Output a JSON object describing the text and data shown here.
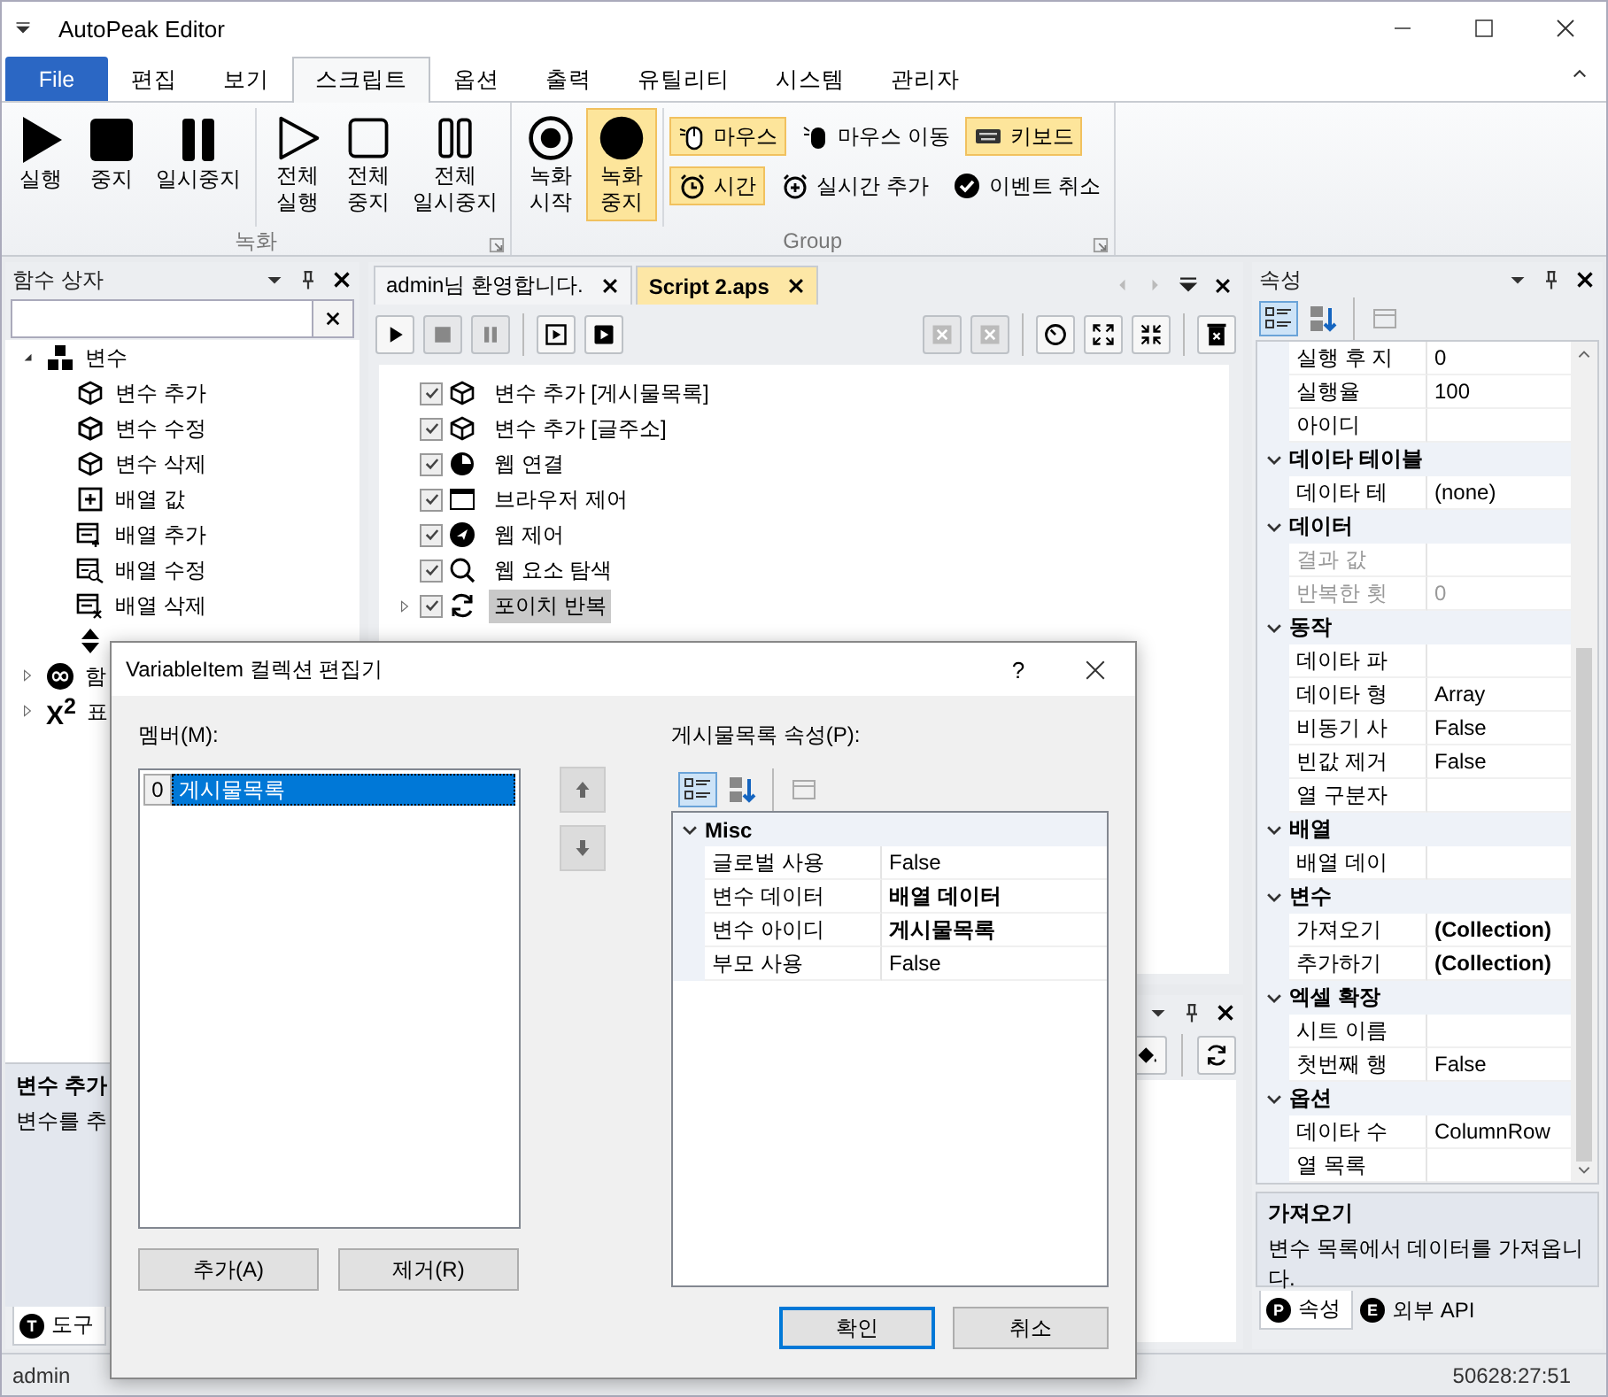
{
  "window": {
    "title": "AutoPeak Editor"
  },
  "menu_tabs": [
    {
      "label": "File",
      "kind": "file",
      "selected": false
    },
    {
      "label": "편집",
      "kind": "tab",
      "selected": false
    },
    {
      "label": "보기",
      "kind": "tab",
      "selected": false
    },
    {
      "label": "스크립트",
      "kind": "tab",
      "selected": true
    },
    {
      "label": "옵션",
      "kind": "tab",
      "selected": false
    },
    {
      "label": "출력",
      "kind": "tab",
      "selected": false
    },
    {
      "label": "유틸리티",
      "kind": "tab",
      "selected": false
    },
    {
      "label": "시스템",
      "kind": "tab",
      "selected": false
    },
    {
      "label": "관리자",
      "kind": "tab",
      "selected": false
    }
  ],
  "ribbon": {
    "groups": [
      {
        "label": "녹화",
        "sections": [
          [
            {
              "kind": "large",
              "label": "실행",
              "selected": false
            },
            {
              "kind": "large",
              "label": "중지",
              "selected": false
            },
            {
              "kind": "large",
              "label": "일시중지",
              "selected": false
            }
          ],
          [
            {
              "kind": "large",
              "label": "전체\n실행",
              "selected": false
            },
            {
              "kind": "large",
              "label": "전체\n중지",
              "selected": false
            },
            {
              "kind": "large",
              "label": "전체\n일시중지",
              "selected": false
            }
          ]
        ]
      },
      {
        "label": "Group",
        "sections": [
          [
            {
              "kind": "large",
              "label": "녹화\n시작",
              "selected": false
            },
            {
              "kind": "large",
              "label": "녹화\n중지",
              "selected": true
            }
          ],
          [
            {
              "kind": "small",
              "label": "마우스",
              "selected": true
            },
            {
              "kind": "small",
              "label": "마우스 이동",
              "selected": false
            },
            {
              "kind": "small",
              "label": "키보드",
              "selected": true
            },
            {
              "kind": "small",
              "label": "시간",
              "selected": true
            },
            {
              "kind": "small",
              "label": "실시간 추가",
              "selected": false
            },
            {
              "kind": "small",
              "label": "이벤트 취소",
              "selected": false
            }
          ]
        ]
      }
    ]
  },
  "function_box": {
    "title": "함수 상자",
    "tree": [
      {
        "label": "변수",
        "expanded": true,
        "children": [
          {
            "kind": "item",
            "label": "변수 추가"
          },
          {
            "kind": "item",
            "label": "변수 수정"
          },
          {
            "kind": "item",
            "label": "변수 삭제"
          },
          {
            "kind": "item",
            "label": "배열 값"
          },
          {
            "kind": "item",
            "label": "배열 추가"
          },
          {
            "kind": "item",
            "label": "배열 수정"
          },
          {
            "kind": "item",
            "label": "배열 삭제"
          },
          {
            "kind": "covered"
          }
        ]
      },
      {
        "label": "함",
        "expanded": false
      },
      {
        "label": "표",
        "expanded": false,
        "icon_text": "X$^{2}$"
      }
    ],
    "description": {
      "title": "변수 추가",
      "text": "변수를 추"
    },
    "bottom_tabs": [
      {
        "label": "도구",
        "badge": "T",
        "selected": true
      }
    ]
  },
  "document": {
    "tabs": [
      {
        "label": "admin님 환영합니다.",
        "selected": false
      },
      {
        "label": "Script 2.aps",
        "selected": true
      }
    ],
    "toolbar": {
      "left": [
        [
          {
            "disabled": false
          },
          {
            "disabled": true
          },
          {
            "disabled": true
          }
        ],
        [
          {
            "disabled": false
          },
          {
            "disabled": false
          }
        ]
      ],
      "right": [
        [
          {
            "disabled": true
          },
          {
            "disabled": true
          }
        ],
        [
          {
            "disabled": false
          },
          {
            "disabled": false
          },
          {
            "disabled": false
          }
        ],
        [
          {
            "disabled": false
          }
        ]
      ]
    },
    "script": [
      {
        "label": "변수 추가 [게시물목록]",
        "checked": true,
        "has_children": false,
        "selected": false
      },
      {
        "label": "변수 추가 [글주소]",
        "checked": true,
        "has_children": false,
        "selected": false
      },
      {
        "label": "웹 연결",
        "checked": true,
        "has_children": false,
        "selected": false
      },
      {
        "label": "브라우저 제어",
        "checked": true,
        "has_children": false,
        "selected": false
      },
      {
        "label": "웹 제어",
        "checked": true,
        "has_children": false,
        "selected": false
      },
      {
        "label": "웹 요소 탐색",
        "checked": true,
        "has_children": false,
        "selected": false
      },
      {
        "label": "포이치 반복",
        "checked": true,
        "has_children": true,
        "selected": true
      }
    ]
  },
  "properties": {
    "title": "속성",
    "categories": [
      {
        "rows": [
          {
            "name": "실행 후 지",
            "value": "0",
            "disabled": false,
            "bold": false
          },
          {
            "name": "실행율",
            "value": "100",
            "disabled": false,
            "bold": false
          },
          {
            "name": "아이디",
            "disabled": false
          }
        ]
      },
      {
        "label": "데이타 테이블",
        "expanded": true,
        "rows": [
          {
            "name": "데이타 테",
            "value": "(none)",
            "disabled": false,
            "bold": false
          }
        ]
      },
      {
        "label": "데이터",
        "expanded": true,
        "rows": [
          {
            "name": "결과 값",
            "disabled": true
          },
          {
            "name": "반복한 횟",
            "value": "0",
            "disabled": true,
            "bold": false
          }
        ]
      },
      {
        "label": "동작",
        "expanded": true,
        "rows": [
          {
            "name": "데이타 파",
            "disabled": false
          },
          {
            "name": "데이타 형",
            "value": "Array",
            "disabled": false,
            "bold": false
          },
          {
            "name": "비동기 사",
            "value": "False",
            "disabled": false,
            "bold": false
          },
          {
            "name": "빈값 제거",
            "value": "False",
            "disabled": false,
            "bold": false
          },
          {
            "name": "열 구분자",
            "disabled": false
          }
        ]
      },
      {
        "label": "배열",
        "expanded": true,
        "rows": [
          {
            "name": "배열 데이",
            "disabled": false
          }
        ]
      },
      {
        "label": "변수",
        "expanded": true,
        "rows": [
          {
            "name": "가져오기",
            "value": "(Collection)",
            "disabled": false,
            "bold": true
          },
          {
            "name": "추가하기",
            "value": "(Collection)",
            "disabled": false,
            "bold": true
          }
        ]
      },
      {
        "label": "엑셀 확장",
        "expanded": true,
        "rows": [
          {
            "name": "시트 이름",
            "disabled": false
          },
          {
            "name": "첫번째 행",
            "value": "False",
            "disabled": false,
            "bold": false
          }
        ]
      },
      {
        "label": "옵션",
        "expanded": true,
        "rows": [
          {
            "name": "데이타 수",
            "value": "ColumnRow",
            "disabled": false,
            "bold": false
          },
          {
            "name": "열 목록",
            "disabled": false
          }
        ]
      }
    ],
    "description": {
      "title": "가져오기",
      "text": "변수 목록에서 데이터를 가져옵니다."
    },
    "bottom_tabs": [
      {
        "label": "속성",
        "badge": "P",
        "selected": true
      },
      {
        "label": "외부 API",
        "badge": "E",
        "selected": false
      }
    ]
  },
  "status_bar": {
    "user": "admin",
    "time": "50628:27:51"
  },
  "dialog": {
    "title": "VariableItem 컬렉션 편집기",
    "help": "?",
    "members_label": "멤버(M):",
    "members": [
      {
        "index": "0",
        "label": "게시물목록",
        "selected": true
      }
    ],
    "add_button": "추가(A)",
    "remove_button": "제거(R)",
    "properties_label": "게시물목록 속성(P):",
    "categories": [
      {
        "label": "Misc",
        "expanded": true,
        "rows": [
          {
            "name": "글로벌 사용",
            "value": "False",
            "disabled": false,
            "bold": false
          },
          {
            "name": "변수 데이터",
            "value": "배열 데이터",
            "disabled": false,
            "bold": true
          },
          {
            "name": "변수 아이디",
            "value": "게시물목록",
            "disabled": false,
            "bold": true
          },
          {
            "name": "부모 사용",
            "value": "False",
            "disabled": false,
            "bold": false
          }
        ]
      }
    ],
    "ok_button": "확인",
    "cancel_button": "취소"
  }
}
